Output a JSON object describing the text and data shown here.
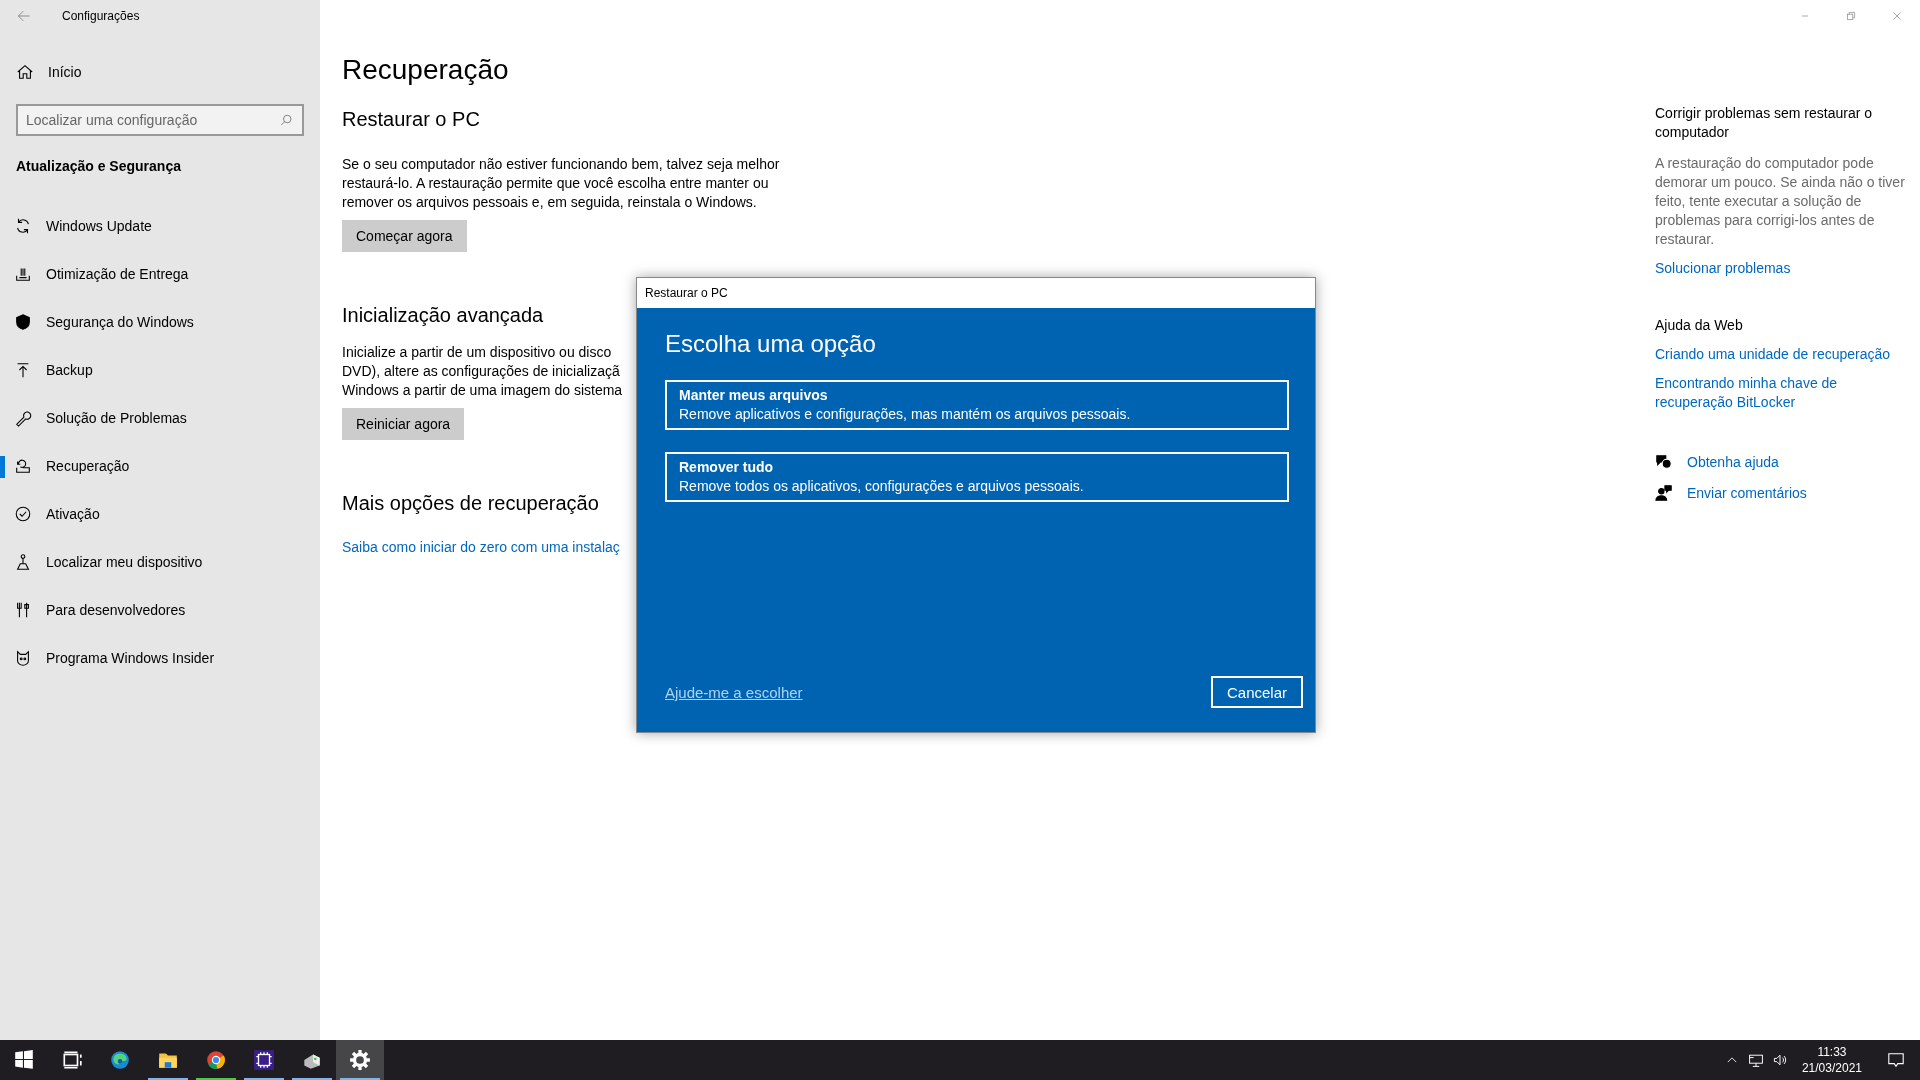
{
  "window": {
    "title": "Configurações"
  },
  "sidebar": {
    "home": "Início",
    "search": {
      "placeholder": "Localizar uma configuração"
    },
    "section": "Atualização e Segurança",
    "items": [
      {
        "label": "Windows Update",
        "selected": false
      },
      {
        "label": "Otimização de Entrega",
        "selected": false
      },
      {
        "label": "Segurança do Windows",
        "selected": false
      },
      {
        "label": "Backup",
        "selected": false
      },
      {
        "label": "Solução de Problemas",
        "selected": false
      },
      {
        "label": "Recuperação",
        "selected": true
      },
      {
        "label": "Ativação",
        "selected": false
      },
      {
        "label": "Localizar meu dispositivo",
        "selected": false
      },
      {
        "label": "Para desenvolvedores",
        "selected": false
      },
      {
        "label": "Programa Windows Insider",
        "selected": false
      }
    ]
  },
  "main": {
    "title": "Recuperação",
    "sections": [
      {
        "heading": "Restaurar o PC",
        "lines": [
          "Se o seu computador não estiver funcionando bem, talvez seja melhor",
          "restaurá-lo. A restauração permite que você escolha entre manter ou",
          "remover os arquivos pessoais e, em seguida, reinstala o Windows."
        ],
        "button": "Começar agora"
      },
      {
        "heading": "Inicialização avançada",
        "lines": [
          "Inicialize a partir de um dispositivo ou disco",
          "DVD), altere as configurações de inicializaçã",
          "Windows a partir de uma imagem do sistema"
        ],
        "button": "Reiniciar agora"
      },
      {
        "heading": "Mais opções de recuperação",
        "link": "Saiba como iniciar do zero com uma instalaç"
      }
    ]
  },
  "aside": {
    "heading": "Corrigir problemas sem restaurar o computador",
    "text": "A restauração do computador pode demorar um pouco. Se ainda não o tiver feito, tente executar a solução de problemas para corrigi-los antes de restaurar.",
    "link": "Solucionar problemas",
    "web_heading": "Ajuda da Web",
    "web_links": [
      "Criando uma unidade de recuperação",
      "Encontrando minha chave de recuperação BitLocker"
    ],
    "actions": [
      "Obtenha ajuda",
      "Enviar comentários"
    ]
  },
  "dialog": {
    "title": "Restaurar o PC",
    "heading": "Escolha uma opção",
    "options": [
      {
        "title": "Manter meus arquivos",
        "description": "Remove aplicativos e configurações, mas mantém os arquivos pessoais."
      },
      {
        "title": "Remover tudo",
        "description": "Remove todos os aplicativos, configurações e arquivos pessoais."
      }
    ],
    "help_link": "Ajude-me a escolher",
    "cancel": "Cancelar"
  },
  "taskbar": {
    "apps": [
      {
        "kind": "start",
        "running": false,
        "active": false
      },
      {
        "kind": "taskview",
        "running": false,
        "active": false
      },
      {
        "kind": "edge",
        "running": false,
        "active": false
      },
      {
        "kind": "folder",
        "running": true,
        "active": false,
        "color": "#76b9ed"
      },
      {
        "kind": "chrome",
        "running": true,
        "active": false,
        "color": "#3cd33c"
      },
      {
        "kind": "chip",
        "running": true,
        "active": false,
        "color": "#76b9ed"
      },
      {
        "kind": "drive",
        "running": true,
        "active": false,
        "color": "#76b9ed"
      },
      {
        "kind": "settings",
        "running": true,
        "active": true,
        "color": "#76b9ed"
      }
    ],
    "time": "11:33",
    "date": "21/03/2021"
  }
}
